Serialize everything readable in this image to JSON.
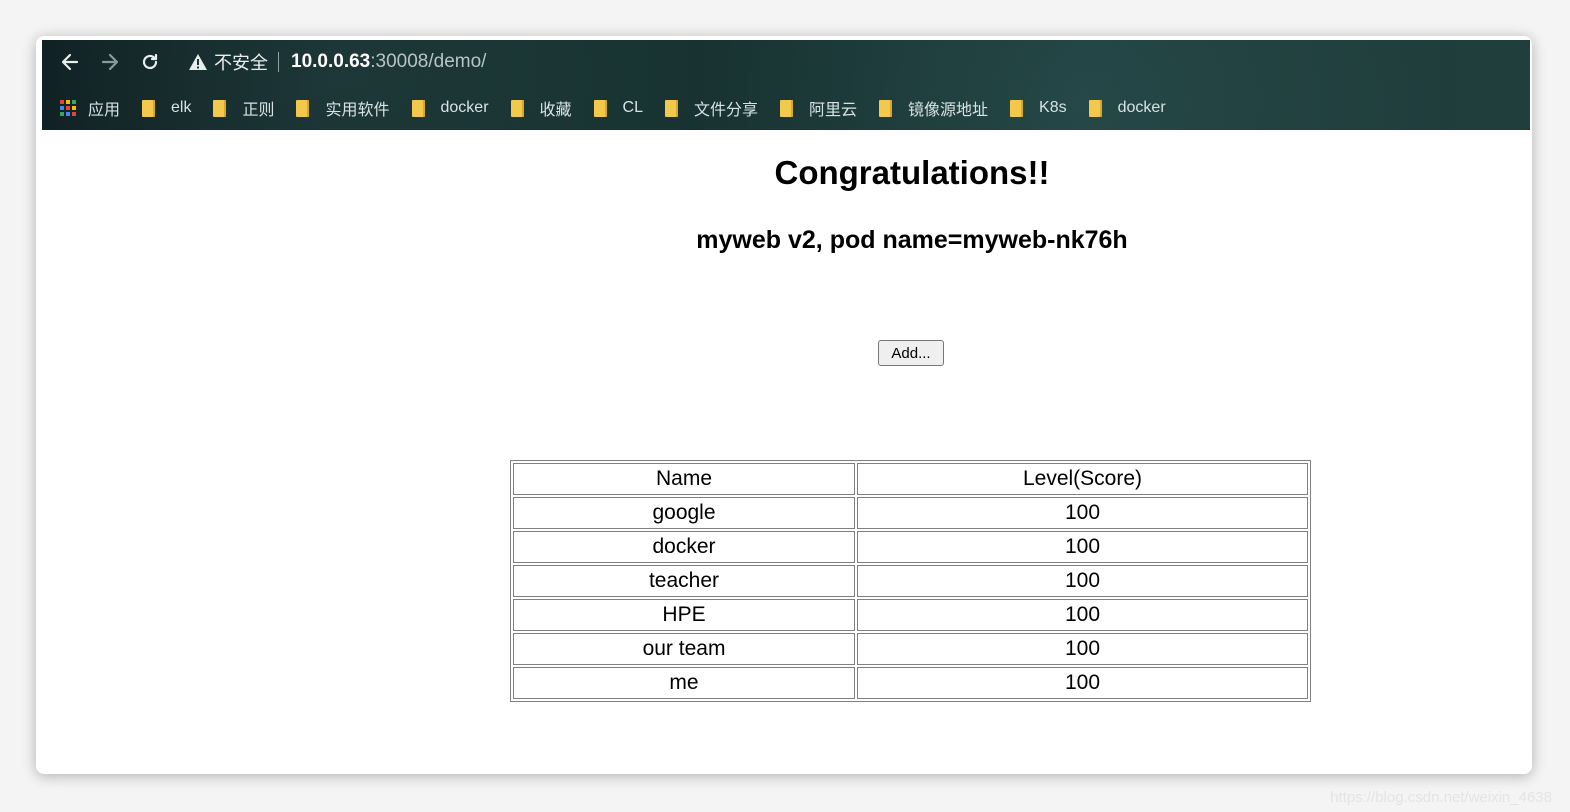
{
  "browser": {
    "insecure_label": "不安全",
    "url_host": "10.0.0.63",
    "url_rest": ":30008/demo/",
    "bookmarks": [
      {
        "label": "应用",
        "type": "apps"
      },
      {
        "label": "elk",
        "type": "folder"
      },
      {
        "label": "正则",
        "type": "folder"
      },
      {
        "label": "实用软件",
        "type": "folder"
      },
      {
        "label": "docker",
        "type": "folder"
      },
      {
        "label": "收藏",
        "type": "folder"
      },
      {
        "label": "CL",
        "type": "folder"
      },
      {
        "label": "文件分享",
        "type": "folder"
      },
      {
        "label": "阿里云",
        "type": "folder"
      },
      {
        "label": "镜像源地址",
        "type": "folder"
      },
      {
        "label": "K8s",
        "type": "folder"
      },
      {
        "label": "docker",
        "type": "folder"
      }
    ]
  },
  "page": {
    "title": "Congratulations!!",
    "subtitle": "myweb v2, pod name=myweb-nk76h",
    "add_button": "Add...",
    "table": {
      "headers": [
        "Name",
        "Level(Score)"
      ],
      "rows": [
        [
          "google",
          "100"
        ],
        [
          "docker",
          "100"
        ],
        [
          "teacher",
          "100"
        ],
        [
          "HPE",
          "100"
        ],
        [
          "our team",
          "100"
        ],
        [
          "me",
          "100"
        ]
      ]
    }
  },
  "watermark": "https://blog.csdn.net/weixin_4638"
}
